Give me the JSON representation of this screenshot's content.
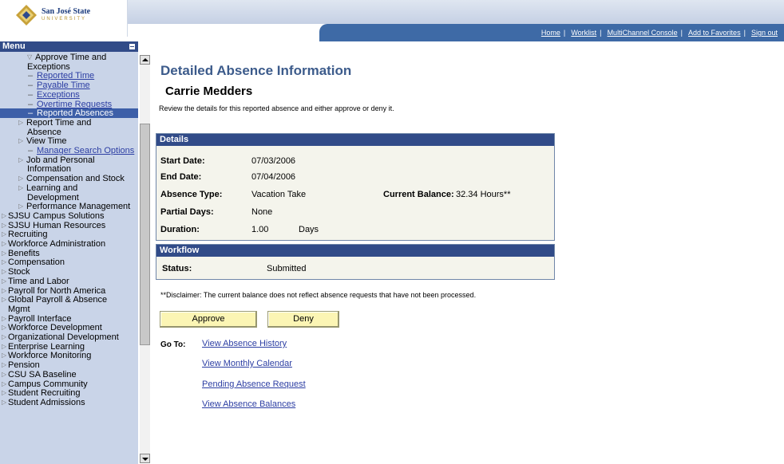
{
  "header": {
    "logo_name": "San José State",
    "logo_sub": "UNIVERSITY",
    "nav_links": [
      "Home",
      "Worklist",
      "MultiChannel Console",
      "Add to Favorites",
      "Sign out"
    ]
  },
  "sidebar": {
    "title": "Menu",
    "items": [
      {
        "text": "Approve Time and",
        "kind": "open"
      },
      {
        "text": "Exceptions",
        "kind": "cont"
      },
      {
        "text": "Reported Time",
        "kind": "link"
      },
      {
        "text": "Payable Time",
        "kind": "link"
      },
      {
        "text": "Exceptions",
        "kind": "link"
      },
      {
        "text": "Overtime Requests",
        "kind": "link"
      },
      {
        "text": "Reported Absences",
        "kind": "selected"
      },
      {
        "text": "Report Time and",
        "kind": "closed"
      },
      {
        "text": "Absence",
        "kind": "cont"
      },
      {
        "text": "View Time",
        "kind": "closed"
      },
      {
        "text": "Manager Search Options",
        "kind": "link"
      },
      {
        "text": "Job and Personal",
        "kind": "closed"
      },
      {
        "text": "Information",
        "kind": "cont"
      },
      {
        "text": "Compensation and Stock",
        "kind": "closed"
      },
      {
        "text": "Learning and",
        "kind": "closed"
      },
      {
        "text": "Development",
        "kind": "cont"
      },
      {
        "text": "Performance Management",
        "kind": "closed"
      },
      {
        "text": "SJSU Campus Solutions",
        "kind": "top"
      },
      {
        "text": "SJSU Human Resources",
        "kind": "top"
      },
      {
        "text": "Recruiting",
        "kind": "top"
      },
      {
        "text": "Workforce Administration",
        "kind": "top"
      },
      {
        "text": "Benefits",
        "kind": "top"
      },
      {
        "text": "Compensation",
        "kind": "top"
      },
      {
        "text": "Stock",
        "kind": "top"
      },
      {
        "text": "Time and Labor",
        "kind": "top"
      },
      {
        "text": "Payroll for North America",
        "kind": "top"
      },
      {
        "text": "Global Payroll & Absence",
        "kind": "top"
      },
      {
        "text": "Mgmt",
        "kind": "topcont"
      },
      {
        "text": "Payroll Interface",
        "kind": "top"
      },
      {
        "text": "Workforce Development",
        "kind": "top"
      },
      {
        "text": "Organizational Development",
        "kind": "top"
      },
      {
        "text": "Enterprise Learning",
        "kind": "top"
      },
      {
        "text": "Workforce Monitoring",
        "kind": "top"
      },
      {
        "text": "Pension",
        "kind": "top"
      },
      {
        "text": "CSU SA Baseline",
        "kind": "top"
      },
      {
        "text": "Campus Community",
        "kind": "top"
      },
      {
        "text": "Student Recruiting",
        "kind": "top"
      },
      {
        "text": "Student Admissions",
        "kind": "top"
      }
    ]
  },
  "main": {
    "title": "Detailed Absence Information",
    "name": "Carrie Medders",
    "instructions": "Review the details for this reported absence and either approve or deny it.",
    "details": {
      "heading": "Details",
      "start_label": "Start Date:",
      "start_value": "07/03/2006",
      "end_label": "End Date:",
      "end_value": "07/04/2006",
      "type_label": "Absence Type:",
      "type_value": "Vacation Take",
      "balance_label": "Current Balance:",
      "balance_value": "32.34 Hours**",
      "partial_label": "Partial Days:",
      "partial_value": "None",
      "duration_label": "Duration:",
      "duration_value": "1.00",
      "duration_unit": "Days"
    },
    "workflow": {
      "heading": "Workflow",
      "status_label": "Status:",
      "status_value": "Submitted"
    },
    "disclaimer": "**Disclaimer: The current balance does not reflect absence requests that have not been processed.",
    "approve_label": "Approve",
    "deny_label": "Deny",
    "goto_label": "Go To:",
    "goto_links": [
      "View Absence History",
      "View Monthly Calendar",
      "Pending Absence Request",
      "View Absence Balances"
    ]
  }
}
